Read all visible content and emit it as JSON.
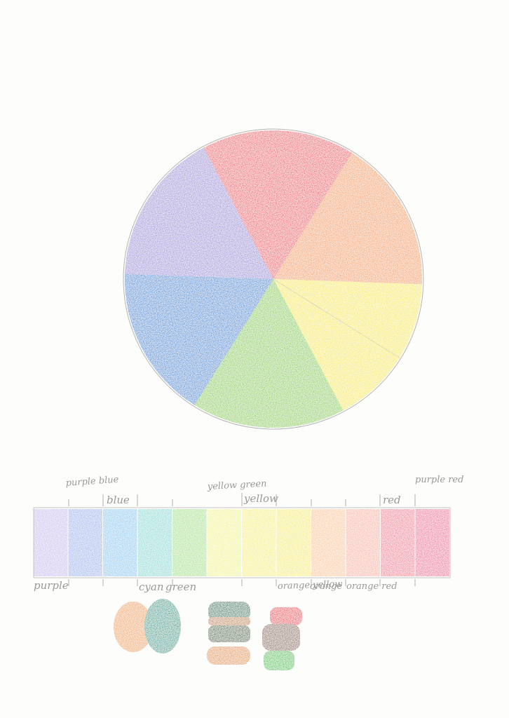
{
  "drawing": {
    "wheel_segments": [
      {
        "name": "red",
        "color": "#ee5a66"
      },
      {
        "name": "orange",
        "color": "#f4a25e"
      },
      {
        "name": "yellow",
        "color": "#f7ec4f"
      },
      {
        "name": "green",
        "color": "#8dd04e"
      },
      {
        "name": "blue",
        "color": "#3d8fd8"
      },
      {
        "name": "purple",
        "color": "#a293da"
      }
    ],
    "strip_colors": [
      "#cdbff0",
      "#9fb7ee",
      "#8ccbf0",
      "#88dcd6",
      "#a8e38c",
      "#f3f58e",
      "#f7f27a",
      "#f6ee6e",
      "#f9c99b",
      "#f8b6a6",
      "#f07f96",
      "#ee6c9b"
    ],
    "labels_top": {
      "purple_blue": "purple blue",
      "blue": "blue",
      "yellow_green": "yellow green",
      "yellow": "yellow",
      "red": "red",
      "purple_red": "purple red"
    },
    "labels_bottom": {
      "purple": "purple",
      "cyan": "cyan",
      "green": "green",
      "orange_yellow": "orange yellow",
      "orange": "orange",
      "orange_red": "orange red"
    },
    "swatch_colors": {
      "mix1_left": "#f0a657",
      "mix1_right": "#2aa08e",
      "mix2_top": "#1e7a5e",
      "mix2_band": "#c58a4a",
      "mix2_dark": "#4c6b3c",
      "mix2_bottom": "#e59a46",
      "mix3_top": "#e83d4b",
      "mix3_mid": "#8d6a58",
      "mix3_bottom": "#46c54d"
    }
  }
}
